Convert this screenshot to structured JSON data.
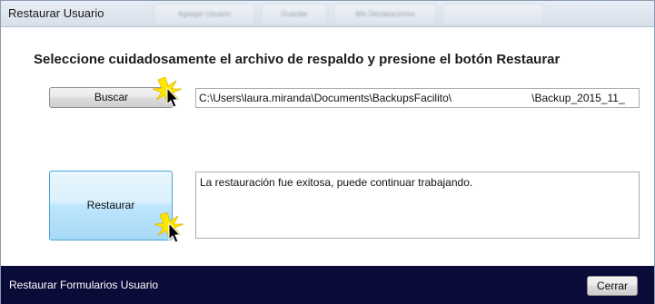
{
  "window": {
    "title": "Restaurar Usuario",
    "background_tabs": [
      "Agregar Usuario",
      "Guardar",
      "Mis Declaraciones",
      ""
    ]
  },
  "main": {
    "heading": "Seleccione cuidadosamente el archivo de respaldo y presione el botón Restaurar",
    "buscar_label": "Buscar",
    "path_prefix": "C:\\Users\\laura.miranda\\Documents\\BackupsFacilito\\",
    "path_suffix": "\\Backup_2015_11_",
    "restaurar_label": "Restaurar",
    "message": "La restauración fue exitosa, puede continuar trabajando."
  },
  "footer": {
    "status_label": "Restaurar Formularios Usuario",
    "cerrar_label": "Cerrar"
  },
  "colors": {
    "footer_bg": "#0b0b3a",
    "highlight_star": "#ffe600",
    "restaurar_border": "#4aa3d8"
  }
}
